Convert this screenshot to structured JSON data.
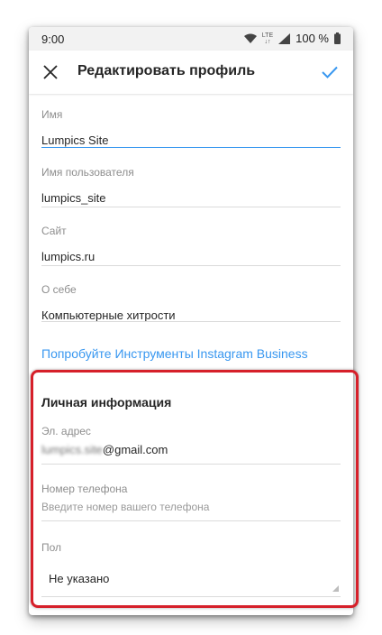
{
  "status_bar": {
    "time": "9:00",
    "network": "LTE",
    "battery": "100 %"
  },
  "app_bar": {
    "title": "Редактировать профиль",
    "close_icon": "close-icon",
    "confirm_icon": "check-icon"
  },
  "fields": {
    "name": {
      "label": "Имя",
      "value": "Lumpics Site"
    },
    "username": {
      "label": "Имя пользователя",
      "value": "lumpics_site"
    },
    "website": {
      "label": "Сайт",
      "value": "lumpics.ru"
    },
    "bio": {
      "label": "О себе",
      "value": "Компьютерные хитрости"
    }
  },
  "business_link": "Попробуйте Инструменты Instagram Business",
  "personal": {
    "title": "Личная информация",
    "email_label": "Эл. адрес",
    "email_blurred": "lumpics.site",
    "email_domain": "@gmail.com",
    "phone_label": "Номер телефона",
    "phone_placeholder": "Введите номер вашего телефона",
    "gender_label": "Пол",
    "gender_value": "Не указано"
  },
  "colors": {
    "accent": "#3897f0",
    "highlight": "#d6202a"
  }
}
